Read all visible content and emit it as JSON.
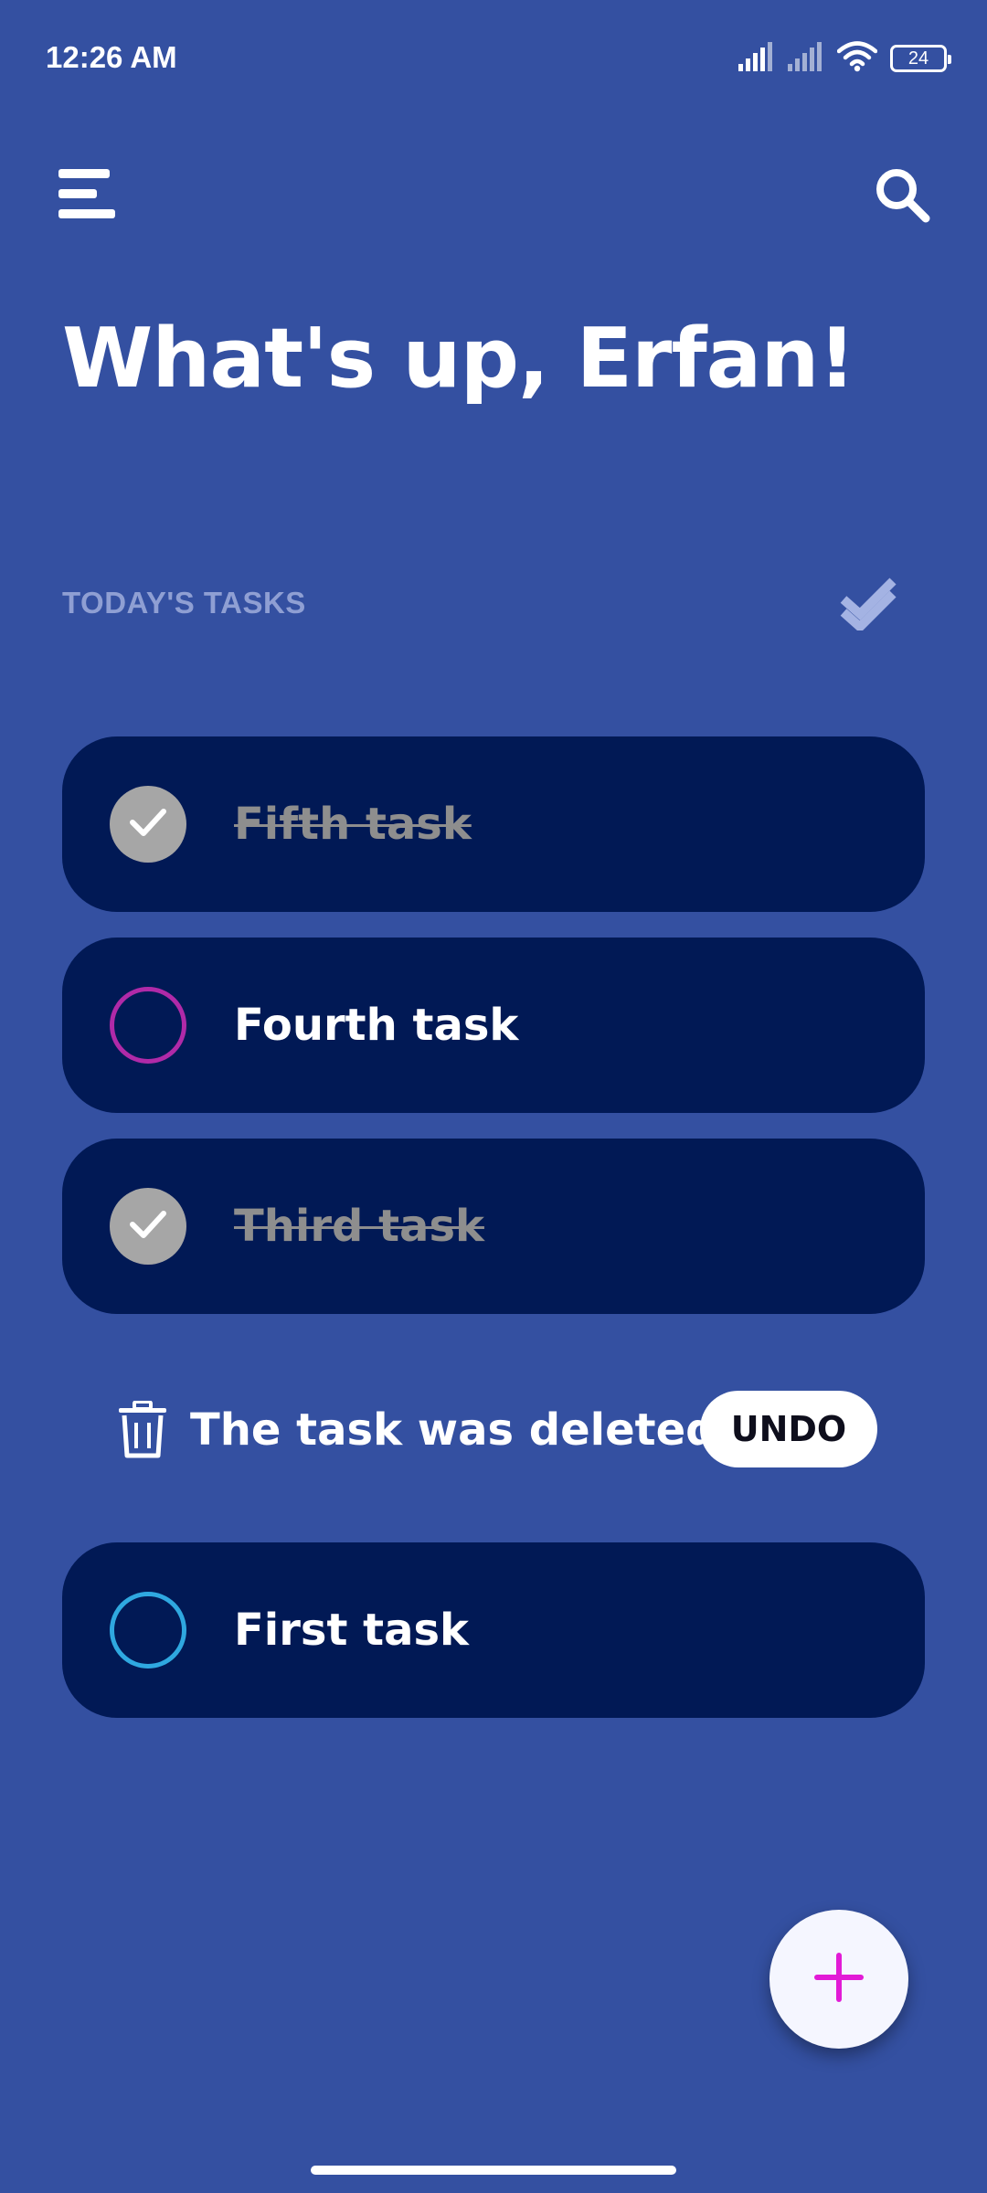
{
  "status_bar": {
    "time": "12:26 AM",
    "battery_level": "24",
    "icons": [
      "signal-icon",
      "signal-icon",
      "wifi-icon",
      "battery-icon"
    ]
  },
  "header": {
    "menu_icon": "menu-icon",
    "search_icon": "search-icon",
    "greeting": "What's up, Erfan!"
  },
  "section": {
    "title": "TODAY'S TASKS",
    "action_icon": "done-all-icon"
  },
  "tasks": [
    {
      "label": "Fifth task",
      "completed": true,
      "ring_color": "#a6a6a6"
    },
    {
      "label": "Fourth task",
      "completed": false,
      "ring_color": "#b02aa8"
    },
    {
      "label": "Third task",
      "completed": true,
      "ring_color": "#a6a6a6"
    },
    {
      "label": "First task",
      "completed": false,
      "ring_color": "#2fa8e0"
    }
  ],
  "snackbar": {
    "icon": "trash-icon",
    "message": "The task was deleted",
    "action_label": "UNDO"
  },
  "fab": {
    "icon": "plus-icon",
    "color": "#e21bd6"
  },
  "colors": {
    "background": "#3450a1",
    "card": "#011955",
    "section_title": "#8f9fd3"
  }
}
